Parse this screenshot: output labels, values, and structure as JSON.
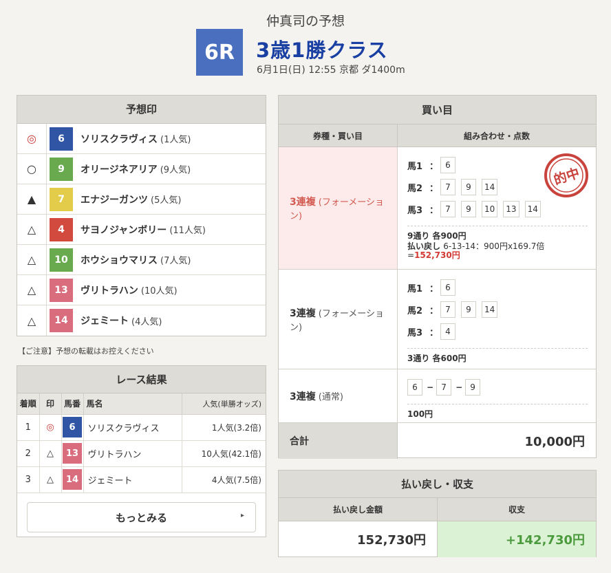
{
  "header": {
    "title": "仲真司の予想",
    "race_no": "6R",
    "race_name": "3歳1勝クラス",
    "race_info": "6月1日(日) 12:55 京都 ダ1400m"
  },
  "marks": {
    "title": "予想印",
    "rows": [
      {
        "mark": "◎",
        "num": "6",
        "color": "#2f55a4",
        "name": "ソリスクラヴィス",
        "pop": "(1人気)"
      },
      {
        "mark": "○",
        "num": "9",
        "color": "#6aaa4e",
        "name": "オリージネアリア",
        "pop": "(9人気)"
      },
      {
        "mark": "▲",
        "num": "7",
        "color": "#e2cc4a",
        "name": "エナジーガンツ",
        "pop": "(5人気)"
      },
      {
        "mark": "△",
        "num": "4",
        "color": "#d24a3d",
        "name": "サヨノジャンボリー",
        "pop": "(11人気)"
      },
      {
        "mark": "△",
        "num": "10",
        "color": "#6aaa4e",
        "name": "ホウショウマリス",
        "pop": "(7人気)"
      },
      {
        "mark": "△",
        "num": "13",
        "color": "#d96d7e",
        "name": "ヴリトラハン",
        "pop": "(10人気)"
      },
      {
        "mark": "△",
        "num": "14",
        "color": "#d96d7e",
        "name": "ジェミート",
        "pop": "(4人気)"
      }
    ]
  },
  "notice": "【ご注意】予想の転載はお控えください",
  "result": {
    "title": "レース結果",
    "headers": {
      "rank": "着順",
      "mark": "印",
      "num": "馬番",
      "name": "馬名",
      "pop": "人気(単勝オッズ)"
    },
    "rows": [
      {
        "rank": "1",
        "mark": "◎",
        "num": "6",
        "color": "#2f55a4",
        "name": "ソリスクラヴィス",
        "pop": "1人気(3.2倍)"
      },
      {
        "rank": "2",
        "mark": "△",
        "num": "13",
        "color": "#d96d7e",
        "name": "ヴリトラハン",
        "pop": "10人気(42.1倍)"
      },
      {
        "rank": "3",
        "mark": "△",
        "num": "14",
        "color": "#d96d7e",
        "name": "ジェミート",
        "pop": "4人気(7.5倍)"
      }
    ],
    "more_label": "もっとみる"
  },
  "bets": {
    "title": "買い目",
    "col1": "券種・買い目",
    "col2": "組み合わせ・点数",
    "stamp_text": "的中",
    "b1": {
      "type": "3連複",
      "sub": "(フォーメーション)",
      "labels": [
        "馬1",
        "馬2",
        "馬3"
      ],
      "r1": [
        "6"
      ],
      "r2": [
        "7",
        "9",
        "14"
      ],
      "r3": [
        "7",
        "9",
        "10",
        "13",
        "14"
      ],
      "summary": "9通り 各900円",
      "pay_label": "払い戻し",
      "pay_detail": "6-13-14：900円x169.7倍=",
      "pay_amount": "152,730円"
    },
    "b2": {
      "type": "3連複",
      "sub": "(フォーメーション)",
      "labels": [
        "馬1",
        "馬2",
        "馬3"
      ],
      "r1": [
        "6"
      ],
      "r2": [
        "7",
        "9",
        "14"
      ],
      "r3": [
        "4"
      ],
      "summary": "3通り 各600円"
    },
    "b3": {
      "type": "3連複",
      "sub": "(通常)",
      "nums": [
        "6",
        "7",
        "9"
      ],
      "summary": "100円"
    },
    "total_label": "合計",
    "total_value": "10,000円"
  },
  "payout": {
    "title": "払い戻し・収支",
    "col1": "払い戻し金額",
    "col2": "収支",
    "amount": "152,730円",
    "balance": "+142,730円"
  },
  "colors": {
    "accent": "#1a3fa3",
    "badge": "#4a6fbe",
    "hit": "#d33a33",
    "plus": "#4b9a3e"
  }
}
